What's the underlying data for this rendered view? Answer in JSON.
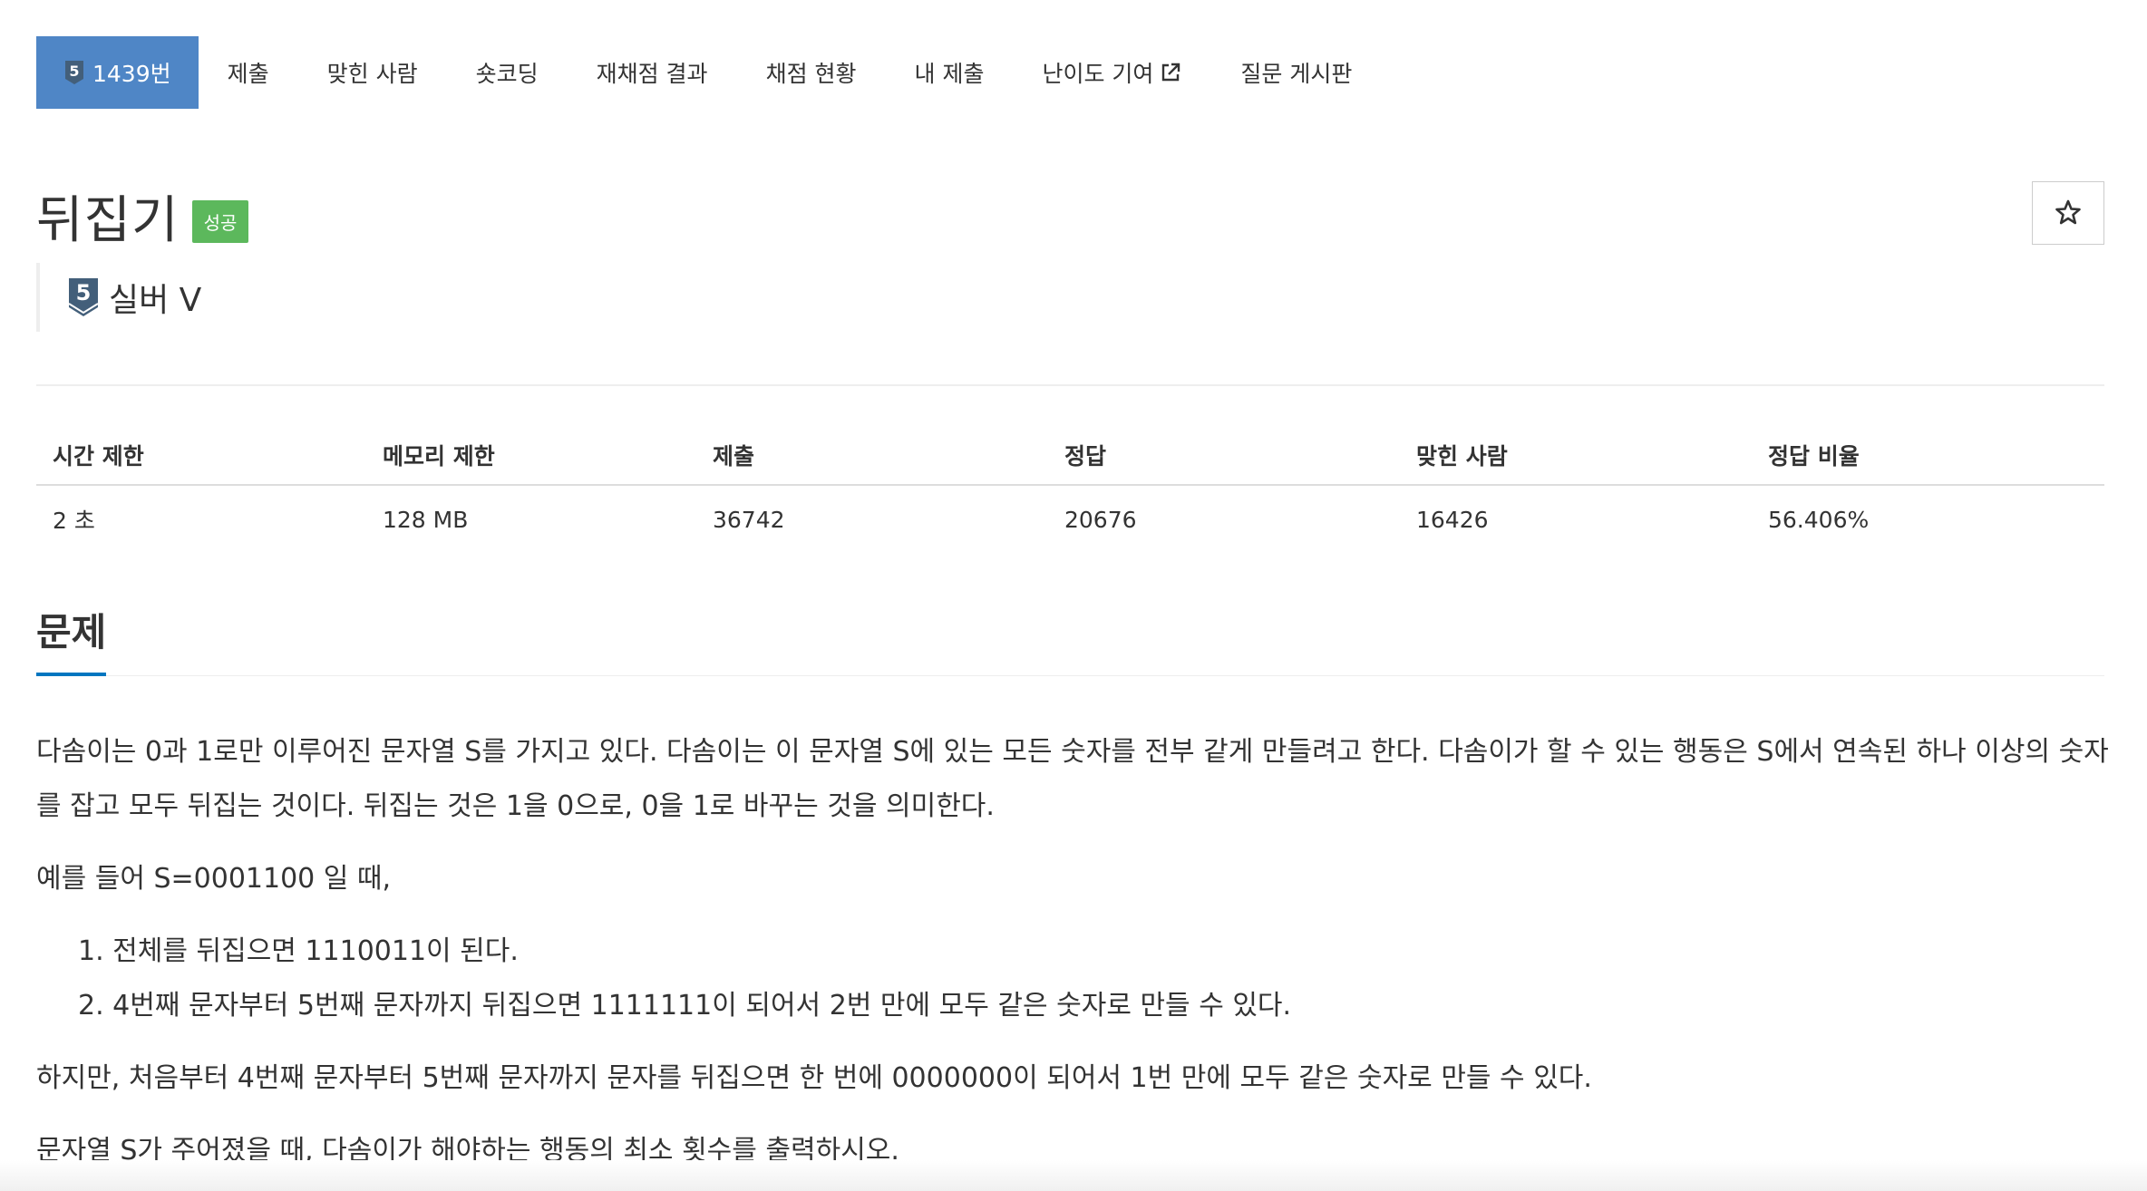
{
  "tabs": [
    {
      "label": "1439번",
      "tier": "5",
      "active": true
    },
    {
      "label": "제출"
    },
    {
      "label": "맞힌 사람"
    },
    {
      "label": "숏코딩"
    },
    {
      "label": "재채점 결과"
    },
    {
      "label": "채점 현황"
    },
    {
      "label": "내 제출"
    },
    {
      "label": "난이도 기여"
    },
    {
      "label": "질문 게시판"
    }
  ],
  "problem": {
    "title": "뒤집기",
    "status": "성공",
    "tier_number": "5",
    "tier_name": "실버 V",
    "favorite_icon": "star-outline-icon"
  },
  "stats": {
    "headers": [
      "시간 제한",
      "메모리 제한",
      "제출",
      "정답",
      "맞힌 사람",
      "정답 비율"
    ],
    "values": [
      "2 초",
      "128 MB",
      "36742",
      "20676",
      "16426",
      "56.406%"
    ]
  },
  "section": {
    "title": "문제"
  },
  "description": {
    "p1": "다솜이는 0과 1로만 이루어진 문자열 S를 가지고 있다. 다솜이는 이 문자열 S에 있는 모든 숫자를 전부 같게 만들려고 한다. 다솜이가 할 수 있는 행동은 S에서 연속된 하나 이상의 숫자를 잡고 모두 뒤집는 것이다. 뒤집는 것은 1을 0으로, 0을 1로 바꾸는 것을 의미한다.",
    "p2": "예를 들어 S=0001100 일 때,",
    "items": [
      "1. 전체를 뒤집으면 1110011이 된다.",
      "2. 4번째 문자부터 5번째 문자까지 뒤집으면 1111111이 되어서 2번 만에 모두 같은 숫자로 만들 수 있다."
    ],
    "p3": "하지만, 처음부터 4번째 문자부터 5번째 문자까지 문자를 뒤집으면 한 번에 0000000이 되어서 1번 만에 모두 같은 숫자로 만들 수 있다.",
    "p4": "문자열 S가 주어졌을 때, 다솜이가 해야하는 행동의 최소 횟수를 출력하시오."
  },
  "colors": {
    "active_tab": "#4f86c6",
    "success": "#5cb85c",
    "tier_silver": "#435f7a",
    "section_underline": "#0076c0"
  }
}
